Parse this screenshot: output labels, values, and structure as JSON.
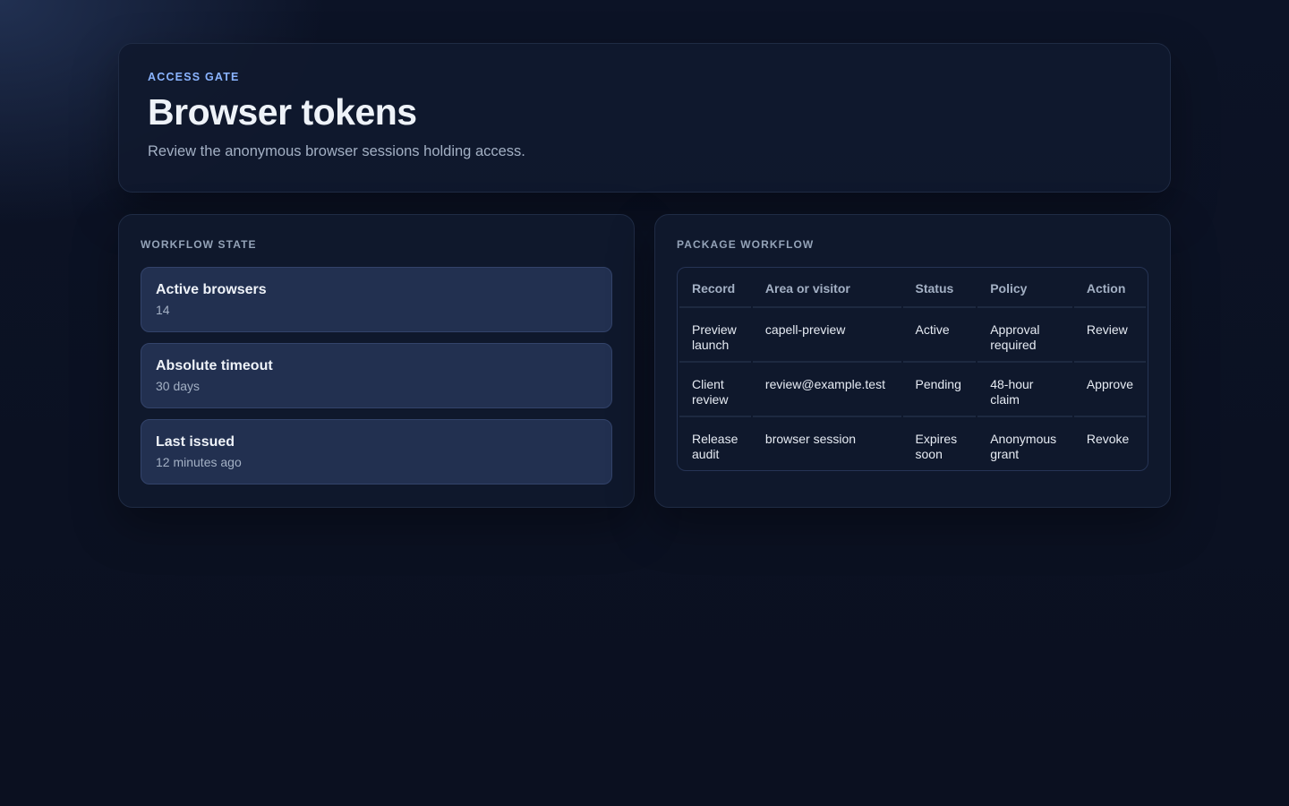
{
  "header": {
    "eyebrow": "ACCESS GATE",
    "title": "Browser tokens",
    "subtitle": "Review the anonymous browser sessions holding access."
  },
  "workflow_state": {
    "label": "WORKFLOW STATE",
    "items": [
      {
        "name": "Active browsers",
        "value": "14"
      },
      {
        "name": "Absolute timeout",
        "value": "30 days"
      },
      {
        "name": "Last issued",
        "value": "12 minutes ago"
      }
    ]
  },
  "package_workflow": {
    "label": "PACKAGE WORKFLOW",
    "columns": [
      "Record",
      "Area or visitor",
      "Status",
      "Policy",
      "Action"
    ],
    "rows": [
      {
        "record": "Preview launch",
        "area": "capell-preview",
        "status": "Active",
        "policy": "Approval required",
        "action": "Review"
      },
      {
        "record": "Client review",
        "area": "review@example.test",
        "status": "Pending",
        "policy": "48-hour claim",
        "action": "Approve"
      },
      {
        "record": "Release audit",
        "area": "browser session",
        "status": "Expires soon",
        "policy": "Anonymous grant",
        "action": "Revoke"
      }
    ]
  },
  "colors": {
    "accent": "#8ab4ff",
    "card": "#223050",
    "panel": "#10192e"
  }
}
